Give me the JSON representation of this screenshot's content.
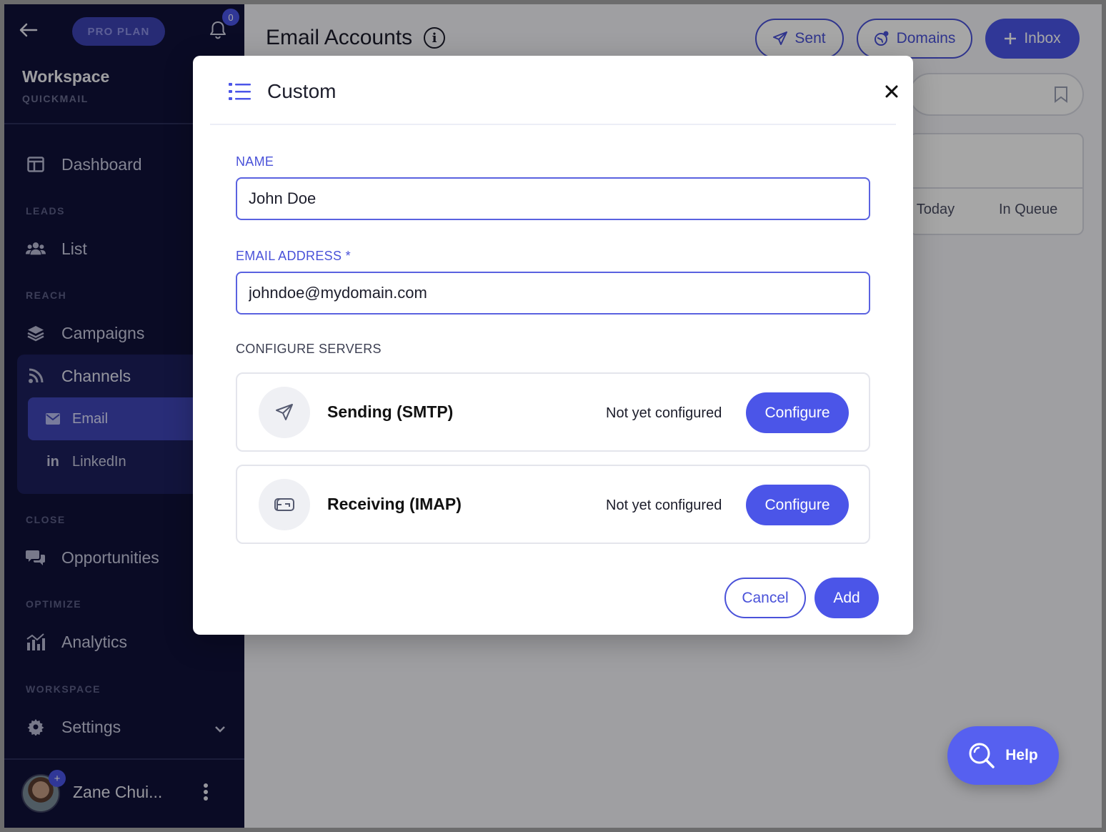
{
  "sidebar": {
    "plan_badge": "PRO PLAN",
    "notification_count": "0",
    "workspace_name": "Workspace",
    "workspace_sub": "QUICKMAIL",
    "dashboard": "Dashboard",
    "sections": {
      "leads": "LEADS",
      "reach": "REACH",
      "close": "CLOSE",
      "optimize": "OPTIMIZE",
      "workspace": "WORKSPACE"
    },
    "list": "List",
    "campaigns": "Campaigns",
    "channels": "Channels",
    "email": "Email",
    "linkedin": "LinkedIn",
    "opportunities": "Opportunities",
    "analytics": "Analytics",
    "settings": "Settings",
    "user_name": "Zane Chui...",
    "avatar_plus": "+"
  },
  "main": {
    "title": "Email Accounts",
    "buttons": {
      "sent": "Sent",
      "domains": "Domains",
      "inbox": "Inbox"
    },
    "columns": {
      "today": ": Today",
      "in_queue": "In Queue"
    }
  },
  "modal": {
    "title": "Custom",
    "name_label": "NAME",
    "name_value": "John Doe",
    "email_label": "EMAIL ADDRESS *",
    "email_value": "johndoe@mydomain.com",
    "configure_servers_label": "CONFIGURE SERVERS",
    "servers": [
      {
        "name": "Sending (SMTP)",
        "status": "Not yet configured",
        "button": "Configure"
      },
      {
        "name": "Receiving (IMAP)",
        "status": "Not yet configured",
        "button": "Configure"
      }
    ],
    "cancel": "Cancel",
    "add": "Add"
  },
  "help": {
    "label": "Help"
  },
  "colors": {
    "accent": "#4b55e8",
    "sidebar_bg": "#10123a",
    "overlay": "rgba(0,0,0,0.35)"
  },
  "icons": [
    "back-arrow-icon",
    "bell-icon",
    "dashboard-icon",
    "users-icon",
    "layers-icon",
    "rss-icon",
    "envelope-icon",
    "linkedin-icon",
    "chat-icon",
    "chart-icon",
    "gear-icon",
    "chevron-down-icon",
    "kebab-icon",
    "info-icon",
    "paper-plane-icon",
    "globe-icon",
    "plus-icon",
    "bookmark-icon",
    "list-icon",
    "close-icon",
    "mailbox-icon",
    "search-icon"
  ]
}
